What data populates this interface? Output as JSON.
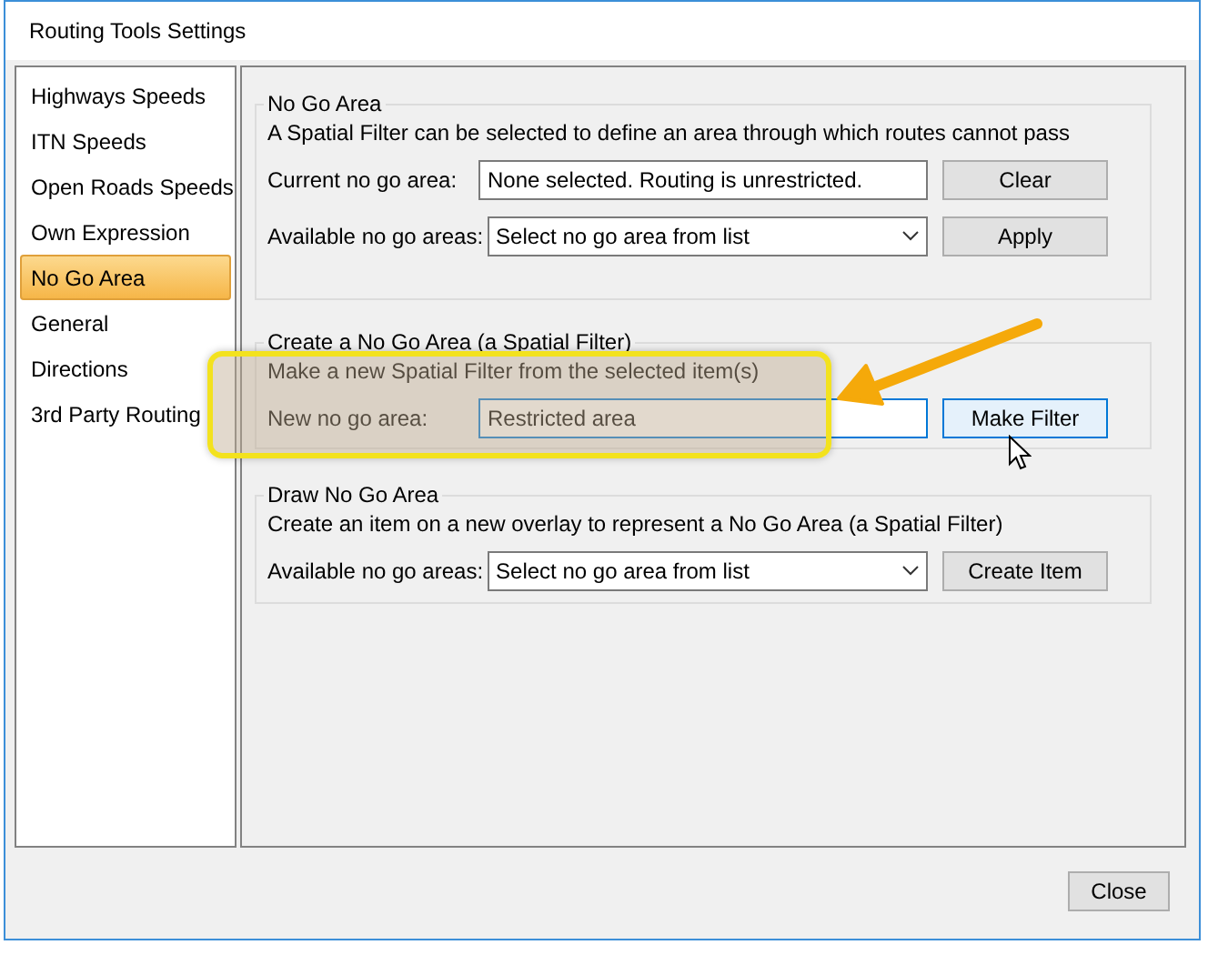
{
  "window": {
    "title": "Routing Tools Settings"
  },
  "sidebar": {
    "items": [
      {
        "label": "Highways Speeds",
        "selected": false
      },
      {
        "label": "ITN Speeds",
        "selected": false
      },
      {
        "label": "Open Roads Speeds",
        "selected": false
      },
      {
        "label": "Own Expression",
        "selected": false
      },
      {
        "label": "No Go Area",
        "selected": true
      },
      {
        "label": "General",
        "selected": false
      },
      {
        "label": "Directions",
        "selected": false
      },
      {
        "label": "3rd Party Routing",
        "selected": false
      }
    ]
  },
  "sections": [
    {
      "title": "No Go Area",
      "description": "A Spatial Filter can be selected to define an area through which routes cannot pass",
      "rows": [
        {
          "label": "Current no go area:",
          "field": {
            "kind": "text",
            "value": "None selected. Routing is unrestricted.",
            "focused": false
          },
          "button": {
            "label": "Clear",
            "focused": false
          }
        },
        {
          "label": "Available no go areas:",
          "field": {
            "kind": "dropdown",
            "value": "Select no go area from list",
            "focused": false
          },
          "button": {
            "label": "Apply",
            "focused": false
          }
        }
      ]
    },
    {
      "title": "Create a No Go Area (a Spatial Filter)",
      "description": "Make a new Spatial Filter from the selected item(s)",
      "rows": [
        {
          "label": "New no go area:",
          "field": {
            "kind": "text",
            "value": "Restricted area",
            "focused": true
          },
          "button": {
            "label": "Make Filter",
            "focused": true
          }
        }
      ]
    },
    {
      "title": "Draw No Go Area",
      "description": "Create an item on a new overlay to represent a No Go Area (a Spatial Filter)",
      "rows": [
        {
          "label": "Available no go areas:",
          "field": {
            "kind": "dropdown",
            "value": "Select no go area from list",
            "focused": false
          },
          "button": {
            "label": "Create Item",
            "focused": false
          }
        }
      ]
    }
  ],
  "footer": {
    "buttons": [
      "Close"
    ]
  }
}
